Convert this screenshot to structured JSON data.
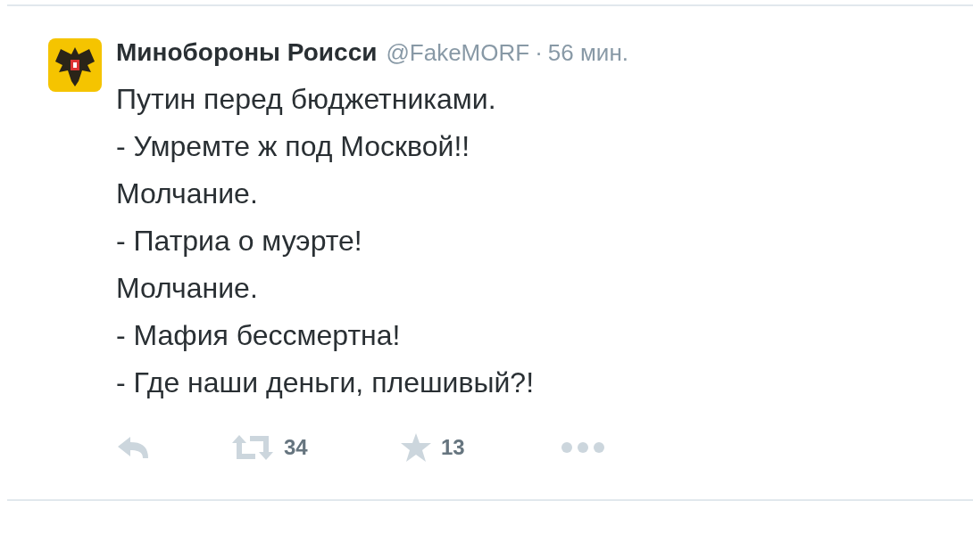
{
  "tweet": {
    "name": "Минобороны Роисси",
    "handle": "@FakeMORF",
    "separator": "·",
    "time": "56 мин.",
    "lines": [
      "Путин перед бюджетниками.",
      "- Умремте ж под Москвой!!",
      "Молчание.",
      "- Патриа о муэрте!",
      "Молчание.",
      "- Мафия бессмертна!",
      "- Где наши деньги, плешивый?!"
    ],
    "actions": [
      {
        "kind": "reply"
      },
      {
        "kind": "retweet",
        "count": "34"
      },
      {
        "kind": "favorite",
        "count": "13"
      },
      {
        "kind": "more"
      }
    ]
  }
}
